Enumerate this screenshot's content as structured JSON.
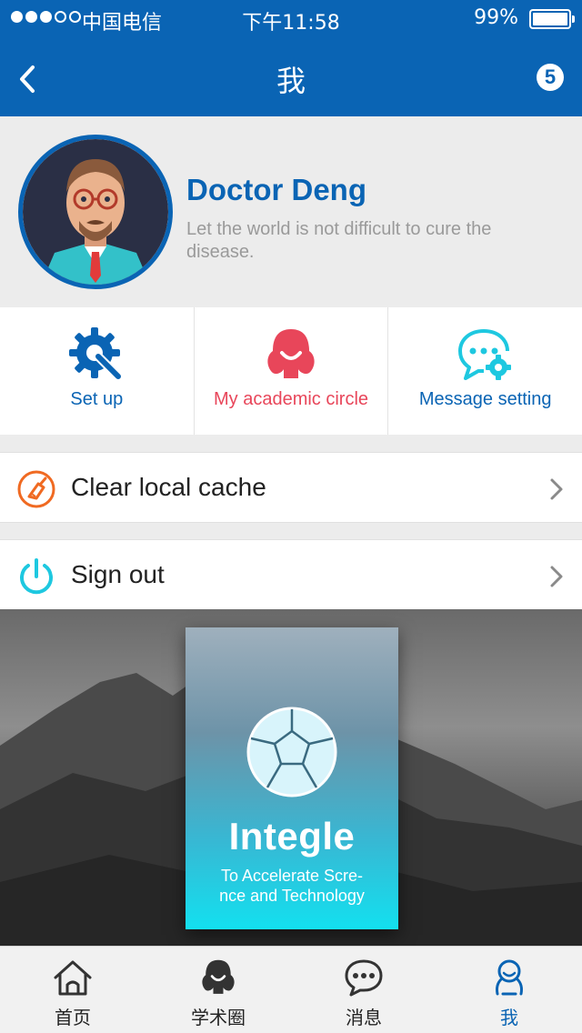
{
  "status_bar": {
    "carrier": "中国电信",
    "time": "下午11:58",
    "battery": "99%"
  },
  "nav": {
    "title": "我",
    "badge_count": "5"
  },
  "profile": {
    "name": "Doctor Deng",
    "motto": "Let the world is not difficult to cure the disease."
  },
  "actions": [
    {
      "label": "Set up",
      "color": "#0a64b4",
      "icon": "gear-wrench-icon"
    },
    {
      "label": "My academic circle",
      "color": "#e8465a",
      "icon": "academic-circle-icon"
    },
    {
      "label": "Message setting",
      "color": "#0a64b4",
      "icon": "message-gear-icon"
    }
  ],
  "list": [
    {
      "label": "Clear local cache",
      "icon": "broom-icon"
    },
    {
      "label": "Sign out",
      "icon": "power-icon"
    }
  ],
  "banner": {
    "brand": "Integle",
    "tagline_line1": "To Accelerate Scre-",
    "tagline_line2": "nce and Technology"
  },
  "tabs": [
    {
      "label": "首页",
      "icon": "home-icon"
    },
    {
      "label": "学术圈",
      "icon": "academic-circle-icon"
    },
    {
      "label": "消息",
      "icon": "chat-icon"
    },
    {
      "label": "我",
      "icon": "person-icon",
      "active": true
    }
  ],
  "colors": {
    "brand_blue": "#0a64b4",
    "accent_red": "#e8465a",
    "accent_cyan": "#1ec8e0",
    "accent_orange": "#f06a22"
  }
}
